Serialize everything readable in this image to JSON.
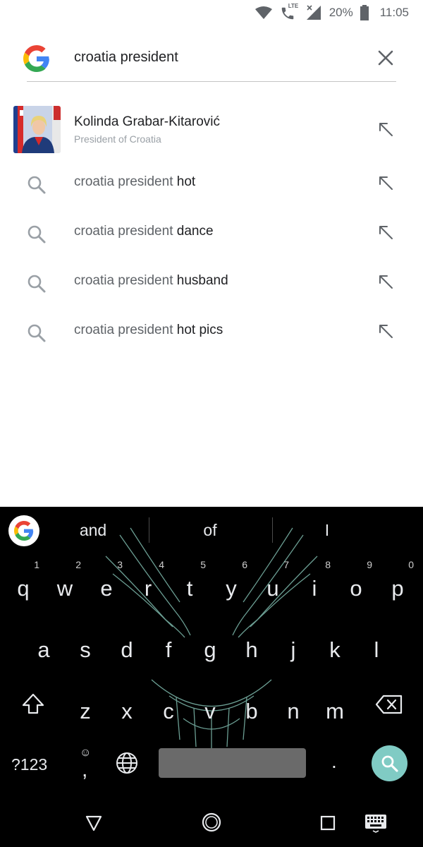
{
  "status": {
    "icons": [
      "wifi-icon",
      "lte-call-icon",
      "signal-icon",
      "battery-icon"
    ],
    "lte_label": "LTE",
    "battery": "20%",
    "time": "11:05"
  },
  "search": {
    "query": "croatia president",
    "clear_icon": "close-icon"
  },
  "entity": {
    "title": "Kolinda Grabar-Kitarović",
    "subtitle": "President of Croatia"
  },
  "suggestions": [
    {
      "prefix": "croatia president",
      "completion": "hot"
    },
    {
      "prefix": "croatia president",
      "completion": "dance"
    },
    {
      "prefix": "croatia president",
      "completion": "husband"
    },
    {
      "prefix": "croatia president",
      "completion": "hot pics"
    }
  ],
  "keyboard": {
    "predictions": [
      "and",
      "of",
      "I"
    ],
    "row1": [
      {
        "k": "q",
        "h": "1"
      },
      {
        "k": "w",
        "h": "2"
      },
      {
        "k": "e",
        "h": "3"
      },
      {
        "k": "r",
        "h": "4"
      },
      {
        "k": "t",
        "h": "5"
      },
      {
        "k": "y",
        "h": "6"
      },
      {
        "k": "u",
        "h": "7"
      },
      {
        "k": "i",
        "h": "8"
      },
      {
        "k": "o",
        "h": "9"
      },
      {
        "k": "p",
        "h": "0"
      }
    ],
    "row2": [
      "a",
      "s",
      "d",
      "f",
      "g",
      "h",
      "j",
      "k",
      "l"
    ],
    "row3": [
      "z",
      "x",
      "c",
      "v",
      "b",
      "n",
      "m"
    ],
    "num_switch": "?123",
    "emoji_smiley": "☺",
    "comma": ",",
    "period": ".",
    "accent_color": "#80cbc4"
  },
  "colors": {
    "google_blue": "#4285F4",
    "google_red": "#EA4335",
    "google_yellow": "#FBBC05",
    "google_green": "#34A853"
  }
}
